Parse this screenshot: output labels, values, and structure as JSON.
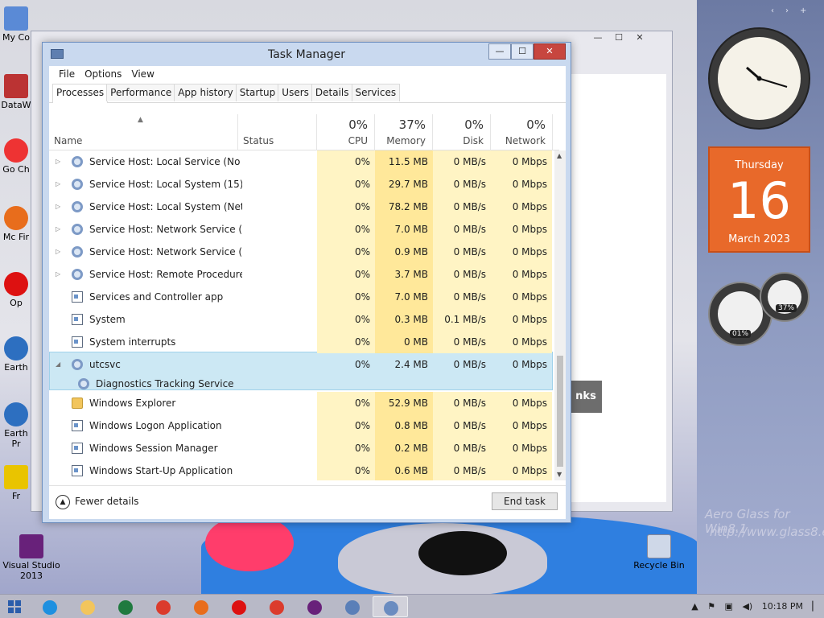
{
  "desktop": {
    "icons": [
      {
        "label": "My Co",
        "icon": "computer-icon"
      },
      {
        "label": "DataW",
        "icon": "program-icon"
      },
      {
        "label": "Go Ch",
        "icon": "chrome-icon"
      },
      {
        "label": "Mc Fir",
        "icon": "firefox-icon"
      },
      {
        "label": "Op",
        "icon": "opera-icon"
      },
      {
        "label": "Earth",
        "icon": "earth-icon"
      },
      {
        "label": "Earth Pr",
        "icon": "earth-icon"
      },
      {
        "label": "Fr",
        "icon": "program-icon"
      },
      {
        "label": "Visual Studio 2013",
        "icon": "visual-studio-icon"
      },
      {
        "label": "Recycle Bin",
        "icon": "recycle-bin-icon"
      }
    ],
    "background_window": {
      "links_text": "nks"
    }
  },
  "task_manager": {
    "title": "Task Manager",
    "window_buttons": {
      "minimize": "—",
      "maximize": "☐",
      "close": "✕"
    },
    "menu": [
      "File",
      "Options",
      "View"
    ],
    "tabs": [
      "Processes",
      "Performance",
      "App history",
      "Startup",
      "Users",
      "Details",
      "Services"
    ],
    "active_tab": "Processes",
    "columns": {
      "name": "Name",
      "status": "Status",
      "cpu": {
        "label": "CPU",
        "pct": "0%"
      },
      "memory": {
        "label": "Memory",
        "pct": "37%"
      },
      "disk": {
        "label": "Disk",
        "pct": "0%"
      },
      "network": {
        "label": "Network",
        "pct": "0%"
      }
    },
    "processes": [
      {
        "name": "Service Host: Local Service (No ...",
        "expand": "▷",
        "icon": "gear",
        "cpu": "0%",
        "memory": "11.5 MB",
        "disk": "0 MB/s",
        "network": "0 Mbps"
      },
      {
        "name": "Service Host: Local System (15)",
        "expand": "▷",
        "icon": "gear",
        "cpu": "0%",
        "memory": "29.7 MB",
        "disk": "0 MB/s",
        "network": "0 Mbps"
      },
      {
        "name": "Service Host: Local System (Net...",
        "expand": "▷",
        "icon": "gear",
        "cpu": "0%",
        "memory": "78.2 MB",
        "disk": "0 MB/s",
        "network": "0 Mbps"
      },
      {
        "name": "Service Host: Network Service (5)",
        "expand": "▷",
        "icon": "gear",
        "cpu": "0%",
        "memory": "7.0 MB",
        "disk": "0 MB/s",
        "network": "0 Mbps"
      },
      {
        "name": "Service Host: Network Service (...",
        "expand": "▷",
        "icon": "gear",
        "cpu": "0%",
        "memory": "0.9 MB",
        "disk": "0 MB/s",
        "network": "0 Mbps"
      },
      {
        "name": "Service Host: Remote Procedure...",
        "expand": "▷",
        "icon": "gear",
        "cpu": "0%",
        "memory": "3.7 MB",
        "disk": "0 MB/s",
        "network": "0 Mbps"
      },
      {
        "name": "Services and Controller app",
        "expand": "",
        "icon": "app",
        "cpu": "0%",
        "memory": "7.0 MB",
        "disk": "0 MB/s",
        "network": "0 Mbps"
      },
      {
        "name": "System",
        "expand": "",
        "icon": "app",
        "cpu": "0%",
        "memory": "0.3 MB",
        "disk": "0.1 MB/s",
        "network": "0 Mbps"
      },
      {
        "name": "System interrupts",
        "expand": "",
        "icon": "app",
        "cpu": "0%",
        "memory": "0 MB",
        "disk": "0 MB/s",
        "network": "0 Mbps"
      },
      {
        "name": "utcsvc",
        "expand": "◢",
        "icon": "gear",
        "cpu": "0%",
        "memory": "2.4 MB",
        "disk": "0 MB/s",
        "network": "0 Mbps",
        "highlighted": true
      },
      {
        "name": "Windows Explorer",
        "expand": "",
        "icon": "folder",
        "cpu": "0%",
        "memory": "52.9 MB",
        "disk": "0 MB/s",
        "network": "0 Mbps"
      },
      {
        "name": "Windows Logon Application",
        "expand": "",
        "icon": "app",
        "cpu": "0%",
        "memory": "0.8 MB",
        "disk": "0 MB/s",
        "network": "0 Mbps"
      },
      {
        "name": "Windows Session Manager",
        "expand": "",
        "icon": "app",
        "cpu": "0%",
        "memory": "0.2 MB",
        "disk": "0 MB/s",
        "network": "0 Mbps"
      },
      {
        "name": "Windows Start-Up Application",
        "expand": "",
        "icon": "app",
        "cpu": "0%",
        "memory": "0.6 MB",
        "disk": "0 MB/s",
        "network": "0 Mbps"
      }
    ],
    "child_service": "Diagnostics Tracking Service",
    "fewer_details": "Fewer details",
    "end_task": "End task"
  },
  "gadgets": {
    "calendar": {
      "day": "Thursday",
      "date": "16",
      "month_year": "March 2023"
    },
    "cpu_meter": "01%",
    "mem_meter": "37%",
    "watermark_1": "Aero Glass for Win8.1",
    "watermark_2": "http://www.glass8.eu"
  },
  "taskbar": {
    "items": [
      "ie-icon",
      "file-explorer-icon",
      "excel-icon",
      "chrome-icon",
      "firefox-icon",
      "opera-icon",
      "chrome-icon",
      "visual-studio-icon",
      "network-icon",
      "task-manager-icon"
    ],
    "time": "10:18 PM"
  },
  "colors": {
    "highlight": "#cce8f4",
    "memory_heat": "#ffe89a",
    "light_heat": "#fff4c4",
    "calendar": "#e8692a"
  }
}
